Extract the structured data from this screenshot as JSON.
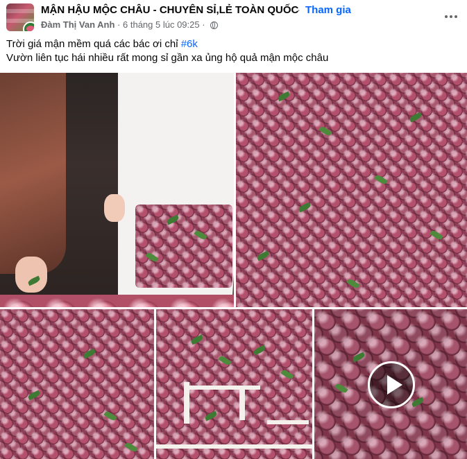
{
  "header": {
    "group_name": "MẬN HẬU MỘC CHÂU - CHUYÊN SỈ,LẺ TOÀN QUỐC",
    "separator": "·",
    "join_label": "Tham gia",
    "author": "Đàm Thị Van Anh",
    "meta_sep": "·",
    "timestamp": "6 tháng 5 lúc 09:25",
    "privacy_icon": "globe-icon",
    "more_icon": "more-horizontal-icon"
  },
  "post": {
    "line1_text": "Trời giá mận mềm quá các bác ơi chỉ ",
    "line1_hashtag": "#6k",
    "line2_text": " Vườn liên tục hái nhiều rất mong sỉ gần xa ủng hộ quả mận mộc châu"
  },
  "media": {
    "photos": [
      {
        "name": "photo-person-picking-plums"
      },
      {
        "name": "photo-pile-of-plums"
      },
      {
        "name": "photo-plums-closeup"
      },
      {
        "name": "photo-plum-crates"
      },
      {
        "name": "video-plums-thumbnail"
      }
    ],
    "play_icon": "play-icon"
  }
}
